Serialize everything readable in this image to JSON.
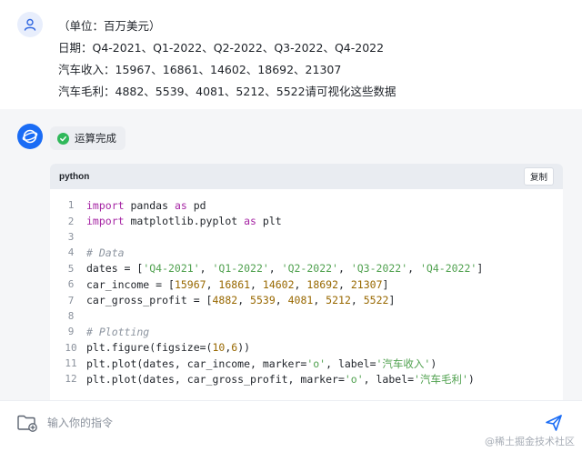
{
  "user_message": {
    "lines": [
      "（单位：百万美元）",
      "日期：Q4-2021、Q1-2022、Q2-2022、Q3-2022、Q4-2022",
      "汽车收入：15967、16861、14602、18692、21307",
      "汽车毛利：4882、5539、4081、5212、5522请可视化这些数据"
    ]
  },
  "assistant": {
    "status_label": "运算完成",
    "code_block": {
      "language": "python",
      "copy_label": "复制",
      "line_numbers": [
        "1",
        "2",
        "3",
        "4",
        "5",
        "6",
        "7",
        "8",
        "9",
        "10",
        "11",
        "12"
      ]
    }
  },
  "input": {
    "placeholder": "输入你的指令"
  },
  "watermark": "@稀土掘金技术社区",
  "colors": {
    "accent": "#1a6cf5",
    "success": "#2fb85a",
    "assistant_bg": "#f5f6f8"
  },
  "icons": {
    "user_avatar": "user-avatar-icon",
    "assistant_avatar": "assistant-logo-icon",
    "status": "check-circle-icon",
    "attach": "folder-add-icon",
    "send": "send-icon"
  }
}
